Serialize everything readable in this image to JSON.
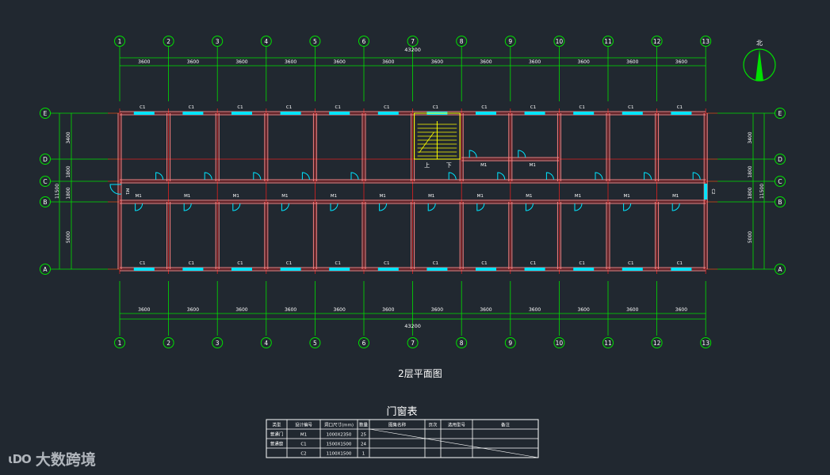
{
  "plan": {
    "axes_x": [
      "1",
      "2",
      "3",
      "4",
      "5",
      "6",
      "7",
      "8",
      "9",
      "10",
      "11",
      "12",
      "13"
    ],
    "axes_y": [
      "E",
      "D",
      "C",
      "B",
      "A"
    ],
    "bay_dims": [
      "3600",
      "3600",
      "3600",
      "3600",
      "3600",
      "3600",
      "3600",
      "3600",
      "3600",
      "3600",
      "3600",
      "3600"
    ],
    "total_dim": "43200",
    "depth_dims_left": [
      "3400",
      "1800",
      "1800",
      "5000"
    ],
    "depth_total": "11500",
    "depth_dims_right": [
      "3400",
      "1800",
      "1800",
      "5000"
    ],
    "window_tag": "C1",
    "door_tag": "M1",
    "end_door_tag": "M1",
    "end_window_tag": "C2",
    "stair_up": "上",
    "stair_down": "下",
    "north_label": "北",
    "title": "2层平面图"
  },
  "schedule": {
    "title": "门窗表",
    "headers": [
      "类型",
      "设计编号",
      "洞口尺寸(mm)",
      "数量",
      "图集名称",
      "页次",
      "选用型号",
      "备注"
    ],
    "rows": [
      {
        "type": "普通门",
        "code": "M1",
        "size": "1000X2350",
        "qty": "25"
      },
      {
        "type": "普通窗",
        "code": "C1",
        "size": "1500X1500",
        "qty": "24"
      },
      {
        "type": "",
        "code": "C2",
        "size": "1100X1500",
        "qty": "1"
      }
    ]
  },
  "watermark": {
    "logo": "ɩDO",
    "text": "大数跨境"
  },
  "colors": {
    "background": "#212830",
    "axis": "#00e000",
    "wall": "#ff8080",
    "grid": "#e02020",
    "window": "#00e5ff",
    "stair": "#ffff00",
    "text": "#ffffff"
  }
}
